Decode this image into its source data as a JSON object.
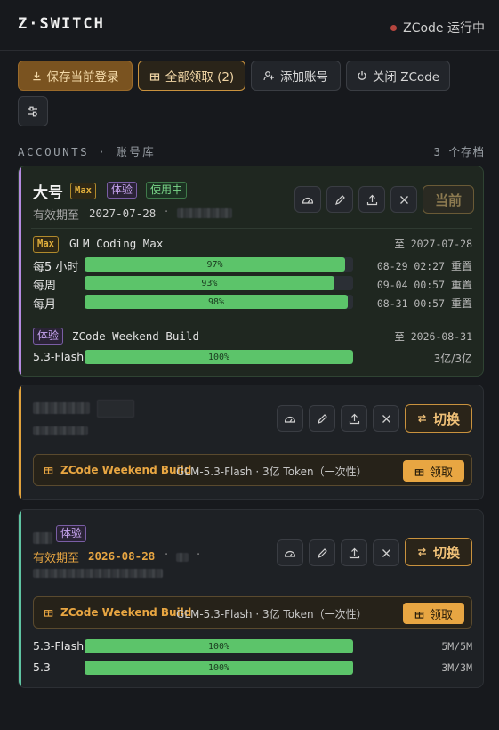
{
  "app": {
    "title": "Z·SWITCH",
    "status": "ZCode 运行中",
    "status_color": "#b5453e"
  },
  "toolbar": {
    "save_label": "保存当前登录",
    "claim_all_label": "全部领取 (2)",
    "add_account_label": "添加账号",
    "close_label": "关闭 ZCode"
  },
  "section": {
    "title": "ACCOUNTS · 账号库",
    "count": "3 个存档"
  },
  "accounts": [
    {
      "name": "大号",
      "badges": [
        "Max",
        "体验",
        "使用中"
      ],
      "expiry_prefix": "有效期至",
      "expiry": "2027-07-28",
      "current_label": "当前",
      "plans": [
        {
          "badge": "Max",
          "name": "GLM Coding Max",
          "until": "至 2027-07-28",
          "rows": [
            {
              "label": "每5 小时",
              "percent": 97,
              "percent_text": "97%",
              "reset_time": "08-29 02:27",
              "reset_label": "重置"
            },
            {
              "label": "每周",
              "percent": 93,
              "percent_text": "93%",
              "reset_time": "09-04 00:57",
              "reset_label": "重置"
            },
            {
              "label": "每月",
              "percent": 98,
              "percent_text": "98%",
              "reset_time": "08-31 00:57",
              "reset_label": "重置"
            }
          ]
        },
        {
          "badge": "体验",
          "name": "ZCode Weekend Build",
          "until": "至 2026-08-31",
          "rows": [
            {
              "label": "5.3-Flash",
              "percent": 100,
              "percent_text": "100%",
              "quota": "3亿/3亿"
            }
          ]
        }
      ]
    },
    {
      "switch_label": "切换",
      "promo": {
        "title": "ZCode Weekend Build",
        "desc": "GLM-5.3-Flash · 3亿 Token（一次性）",
        "claim_label": "领取"
      }
    },
    {
      "badges": [
        "体验"
      ],
      "expiry_prefix": "有效期至",
      "expiry": "2026-08-28",
      "switch_label": "切换",
      "promo": {
        "title": "ZCode Weekend Build",
        "desc": "GLM-5.3-Flash · 3亿 Token（一次性）",
        "claim_label": "领取"
      },
      "rows": [
        {
          "label": "5.3-Flash",
          "percent": 100,
          "percent_text": "100%",
          "quota": "5M/5M"
        },
        {
          "label": "5.3",
          "percent": 100,
          "percent_text": "100%",
          "quota": "3M/3M"
        }
      ]
    }
  ],
  "colors": {
    "accent": "#e8a642",
    "bar_fill": "#5cc46a",
    "active_border": "#b58be0"
  }
}
